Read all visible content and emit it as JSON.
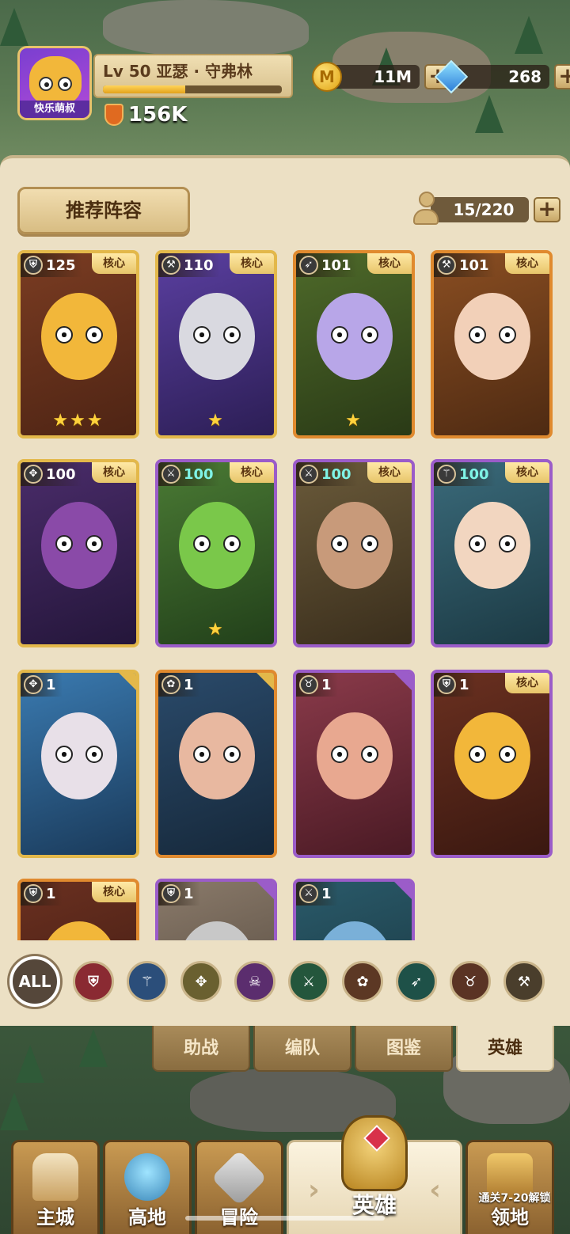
{
  "player": {
    "avatar_name": "快乐萌叔",
    "level_name": "Lv 50  亚瑟 · 守弗林",
    "xp_fraction": 0.46,
    "power": "156K"
  },
  "currency": {
    "coins": "11M",
    "gems": "268"
  },
  "panel": {
    "recommend_label": "推荐阵容",
    "capacity": "15/220"
  },
  "heroes": [
    {
      "level": "125",
      "class_icon": "shield-icon",
      "core": "核心",
      "stars": "★★★",
      "rarity": "gold"
    },
    {
      "level": "110",
      "class_icon": "axe-icon",
      "core": "核心",
      "stars": "★",
      "rarity": "gold"
    },
    {
      "level": "101",
      "class_icon": "bow-icon",
      "core": "核心",
      "stars": "★",
      "rarity": "orange"
    },
    {
      "level": "101",
      "class_icon": "axe-icon",
      "core": "核心",
      "stars": "",
      "rarity": "orange"
    },
    {
      "level": "100",
      "class_icon": "wings-icon",
      "core": "核心",
      "stars": "",
      "rarity": "gold"
    },
    {
      "level": "100",
      "class_icon": "swords-icon",
      "core": "核心",
      "stars": "★",
      "rarity": "purple"
    },
    {
      "level": "100",
      "class_icon": "swords-icon",
      "core": "核心",
      "stars": "",
      "rarity": "purple"
    },
    {
      "level": "100",
      "class_icon": "staff-icon",
      "core": "核心",
      "stars": "",
      "rarity": "purple"
    },
    {
      "level": "1",
      "class_icon": "wings-icon",
      "core": "",
      "stars": "",
      "rarity": "gold"
    },
    {
      "level": "1",
      "class_icon": "paw-icon",
      "core": "",
      "stars": "",
      "rarity": "orange"
    },
    {
      "level": "1",
      "class_icon": "beast-icon",
      "core": "",
      "stars": "",
      "rarity": "purple"
    },
    {
      "level": "1",
      "class_icon": "shield-icon",
      "core": "核心",
      "stars": "",
      "rarity": "purple"
    },
    {
      "level": "1",
      "class_icon": "shield-icon",
      "core": "核心",
      "stars": "",
      "rarity": "orange"
    },
    {
      "level": "1",
      "class_icon": "shield-icon",
      "core": "",
      "stars": "",
      "rarity": "purple"
    },
    {
      "level": "1",
      "class_icon": "swords-icon",
      "core": "",
      "stars": "",
      "rarity": "purple"
    }
  ],
  "filters": {
    "all_label": "ALL",
    "items": [
      "shield-icon",
      "staff-icon",
      "wings-icon",
      "skull-icon",
      "swords-icon",
      "paw-icon",
      "bow-icon",
      "beast-icon",
      "axe-icon"
    ]
  },
  "tabs": [
    "助战",
    "编队",
    "图鉴",
    "英雄"
  ],
  "active_tab": 3,
  "nav": {
    "items": [
      "主城",
      "高地",
      "冒险",
      "英雄",
      "领地"
    ],
    "unlock_hint": "通关7-20解锁"
  }
}
